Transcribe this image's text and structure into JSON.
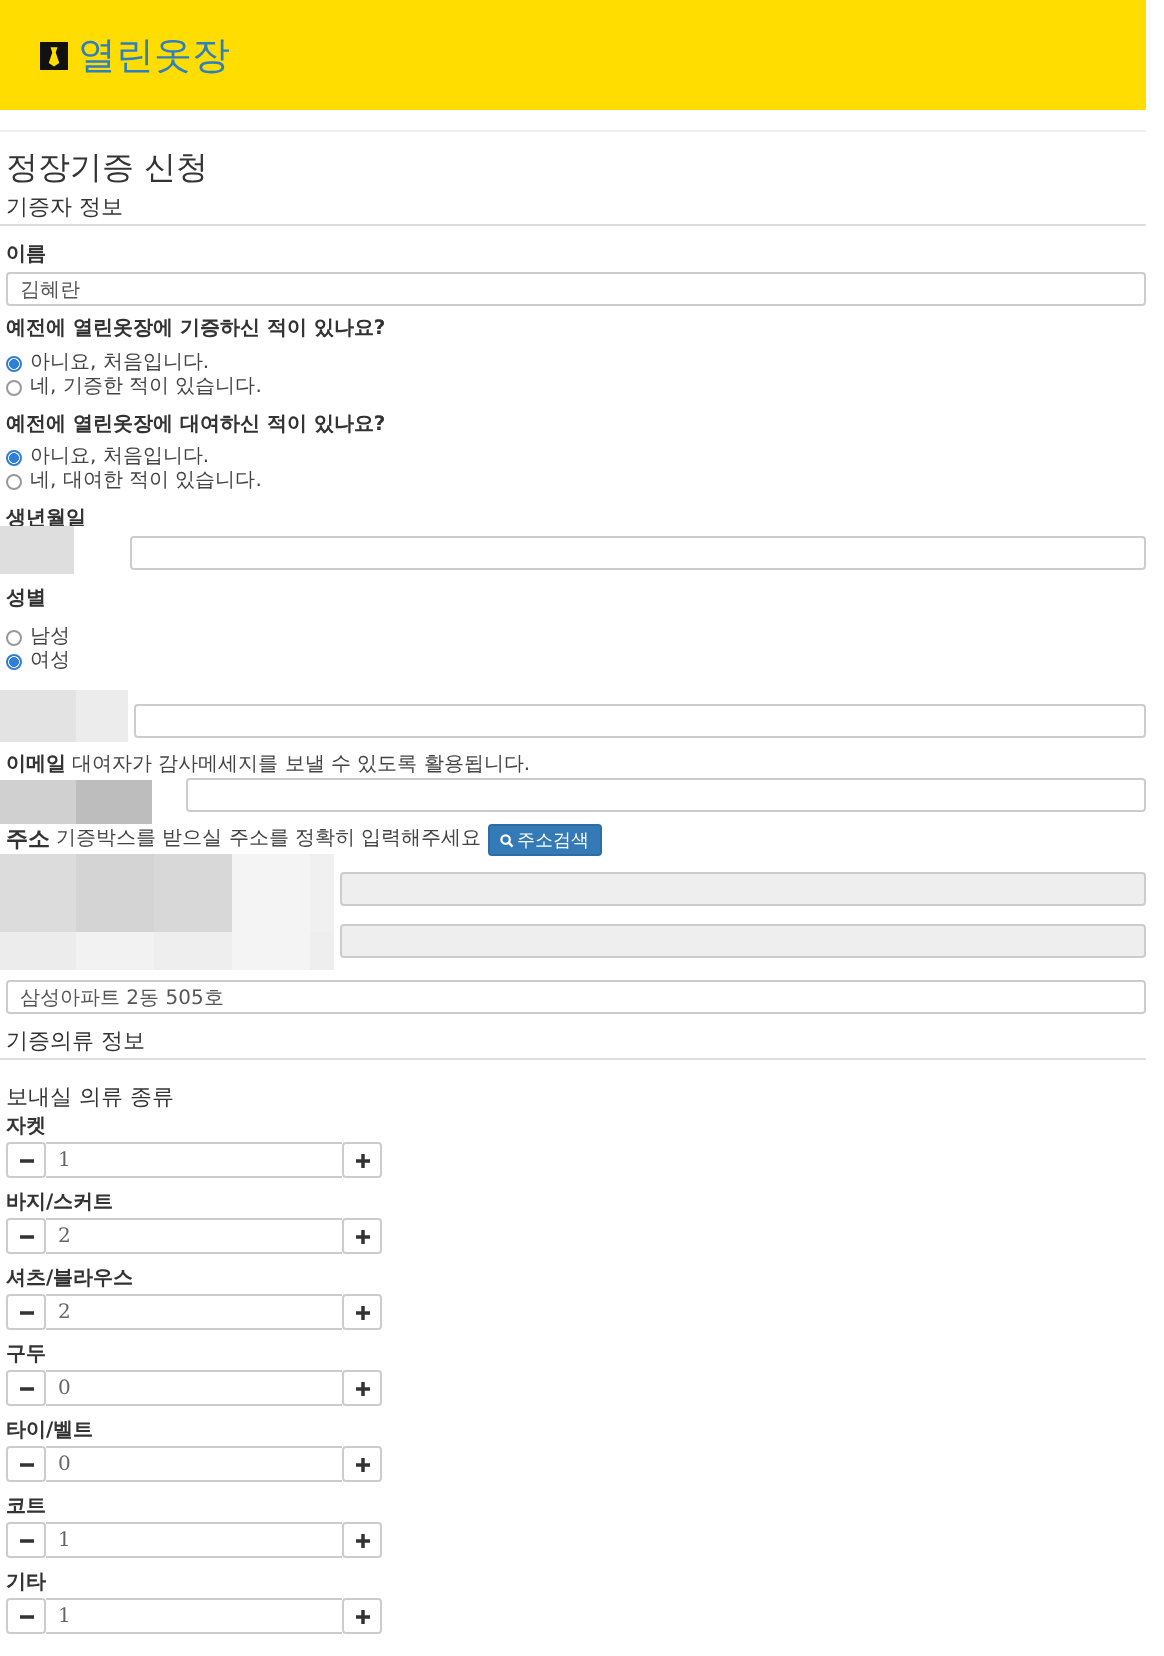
{
  "header": {
    "logo_text": "열린옷장"
  },
  "page_title": "정장기증 신청",
  "donor_section": {
    "title": "기증자 정보",
    "name": {
      "label": "이름",
      "value": "김혜란"
    },
    "questions": [
      {
        "label": "예전에 열린옷장에 기증하신 적이 있나요?",
        "options": [
          {
            "label": "아니요, 처음입니다.",
            "selected": true
          },
          {
            "label": "네, 기증한 적이 있습니다.",
            "selected": false
          }
        ]
      },
      {
        "label": "예전에 열린옷장에 대여하신 적이 있나요?",
        "options": [
          {
            "label": "아니요, 처음입니다.",
            "selected": true
          },
          {
            "label": "네, 대여한 적이 있습니다.",
            "selected": false
          }
        ]
      }
    ],
    "birthdate": {
      "label": "생년월일"
    },
    "gender": {
      "label": "성별",
      "options": [
        {
          "label": "남성",
          "selected": false
        },
        {
          "label": "여성",
          "selected": true
        }
      ]
    },
    "email": {
      "label": "이메일",
      "hint": "대여자가 감사메세지를 보낼 수 있도록 활용됩니다."
    },
    "address": {
      "label": "주소",
      "hint": "기증박스를 받으실 주소를 정확히 입력해주세요",
      "button": "주소검색",
      "detail_value": "삼성아파트 2동 505호"
    }
  },
  "clothing_section": {
    "title": "기증의류 정보",
    "subtitle": "보내실 의류 종류",
    "items": [
      {
        "label": "자켓",
        "value": "1"
      },
      {
        "label": "바지/스커트",
        "value": "2"
      },
      {
        "label": "셔츠/블라우스",
        "value": "2"
      },
      {
        "label": "구두",
        "value": "0"
      },
      {
        "label": "타이/벨트",
        "value": "0"
      },
      {
        "label": "코트",
        "value": "1"
      },
      {
        "label": "기타",
        "value": "1"
      }
    ]
  }
}
